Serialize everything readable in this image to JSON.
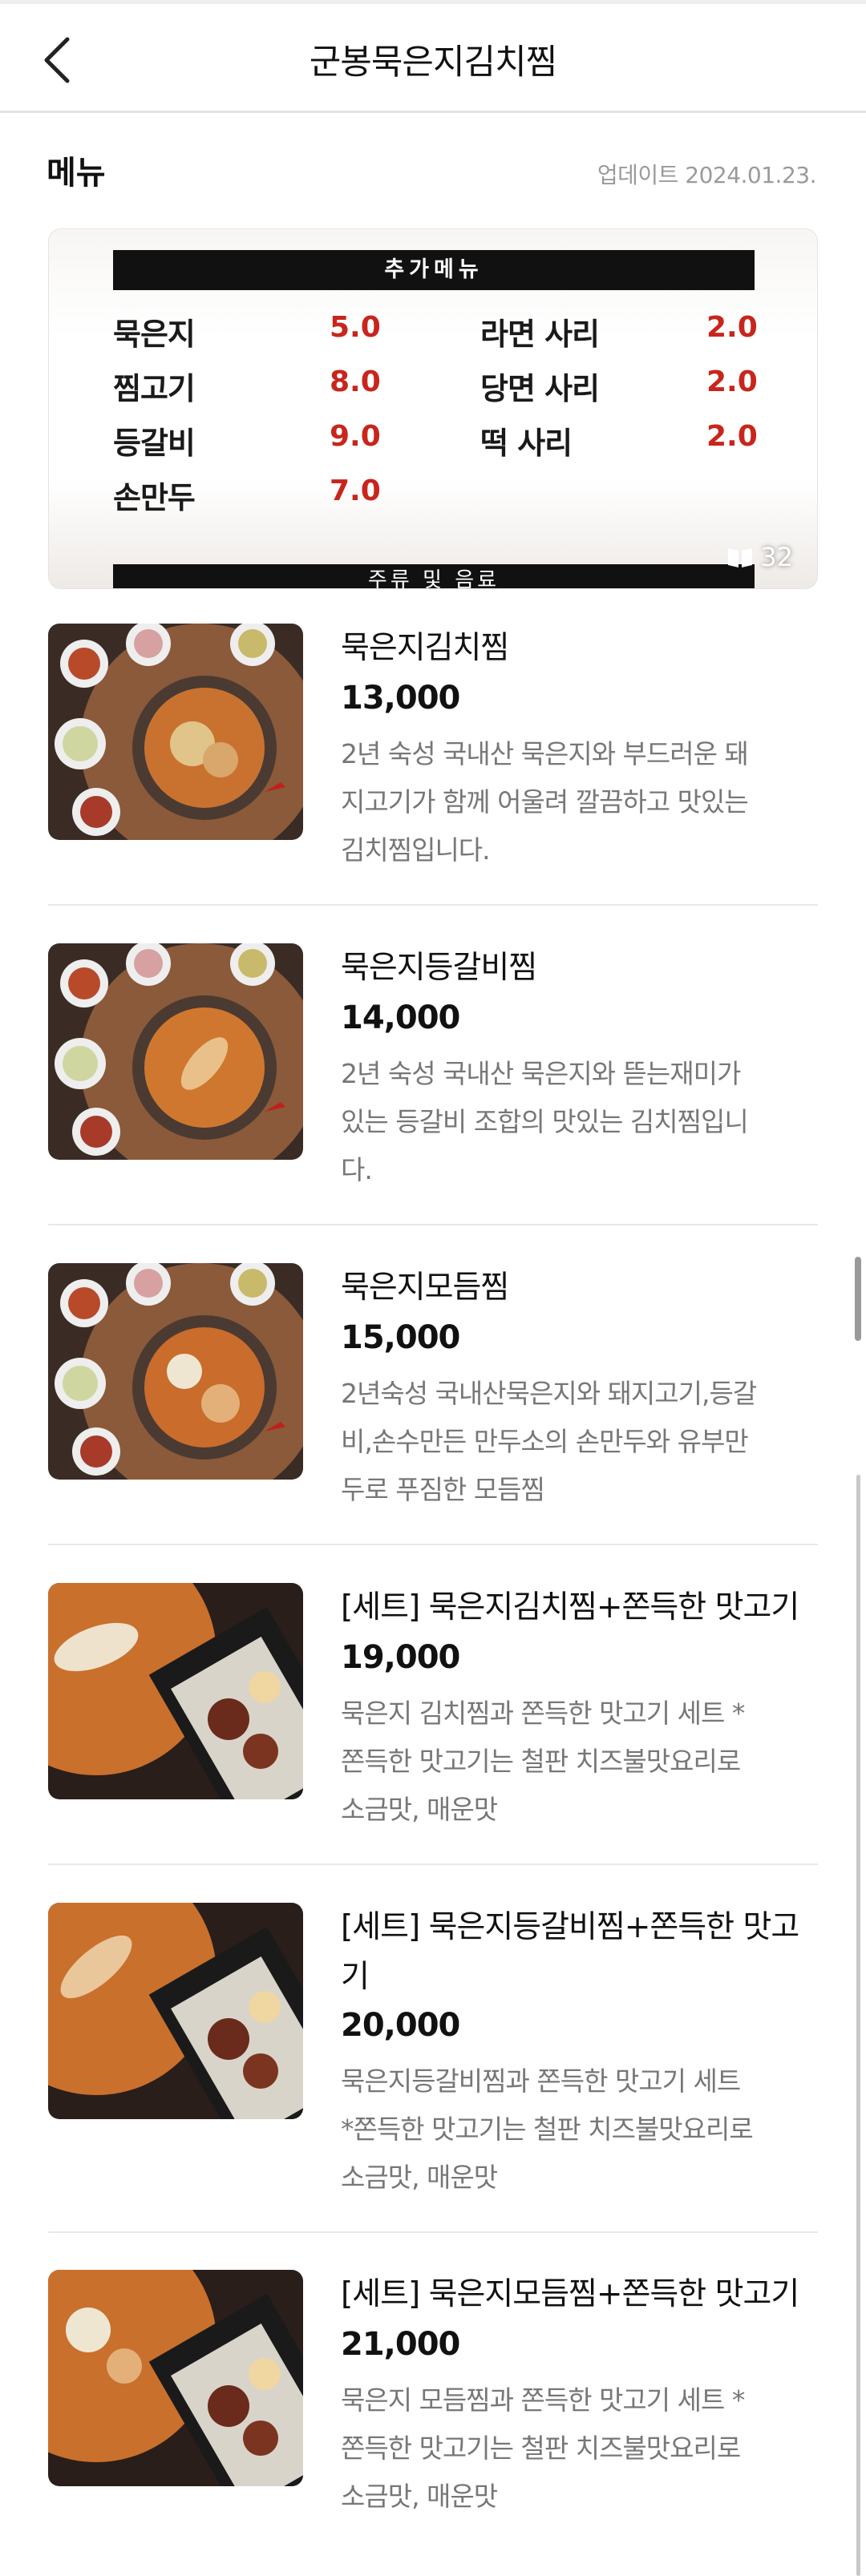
{
  "header": {
    "title": "군봉묵은지김치찜",
    "back_icon": "chevron-left-icon"
  },
  "section": {
    "title": "메뉴",
    "update": "업데이트 2024.01.23."
  },
  "board": {
    "header": "추가메뉴",
    "left_items": [
      {
        "name": "묵은지",
        "price": "5.0"
      },
      {
        "name": "찜고기",
        "price": "8.0"
      },
      {
        "name": "등갈비",
        "price": "9.0"
      },
      {
        "name": "손만두",
        "price": "7.0"
      }
    ],
    "right_items": [
      {
        "name": "라면 사리",
        "price": "2.0"
      },
      {
        "name": "당면 사리",
        "price": "2.0"
      },
      {
        "name": "떡 사리",
        "price": "2.0"
      }
    ],
    "footer": "주류 및 음료",
    "photo_count": "32",
    "photo_icon": "book-open-icon",
    "price_color": "#c8261c"
  },
  "menu": [
    {
      "name": "묵은지김치찜",
      "price": "13,000",
      "desc": [
        "2년 숙성 국내산 묵은지와 부드러운 돼",
        "지고기가 함께 어울려 깔끔하고 맛있는",
        "김치찜입니다."
      ]
    },
    {
      "name": "묵은지등갈비찜",
      "price": "14,000",
      "desc": [
        "2년 숙성 국내산 묵은지와 뜯는재미가",
        "있는 등갈비 조합의 맛있는 김치찜입니",
        "다."
      ]
    },
    {
      "name": "묵은지모듬찜",
      "price": "15,000",
      "desc": [
        "2년숙성 국내산묵은지와 돼지고기,등갈",
        "비,손수만든 만두소의 손만두와 유부만",
        "두로 푸짐한 모듬찜"
      ]
    },
    {
      "name": "[세트] 묵은지김치찜+쫀득한 맛고기",
      "price": "19,000",
      "desc": [
        "묵은지 김치찜과 쫀득한 맛고기 세트 *",
        "쫀득한 맛고기는 철판 치즈불맛요리로",
        "소금맛, 매운맛"
      ]
    },
    {
      "name": "[세트] 묵은지등갈비찜+쫀득한 맛고기",
      "name_lines": [
        "[세트] 묵은지등갈비찜+쫀득한 맛고",
        "기"
      ],
      "price": "20,000",
      "desc": [
        "묵은지등갈비찜과 쫀득한 맛고기 세트",
        "*쫀득한 맛고기는 철판 치즈불맛요리로",
        "소금맛, 매운맛"
      ]
    },
    {
      "name": "[세트] 묵은지모듬찜+쫀득한 맛고기",
      "price": "21,000",
      "desc": [
        "묵은지 모듬찜과 쫀득한 맛고기 세트 *",
        "쫀득한 맛고기는 철판 치즈불맛요리로",
        "소금맛, 매운맛"
      ]
    }
  ]
}
